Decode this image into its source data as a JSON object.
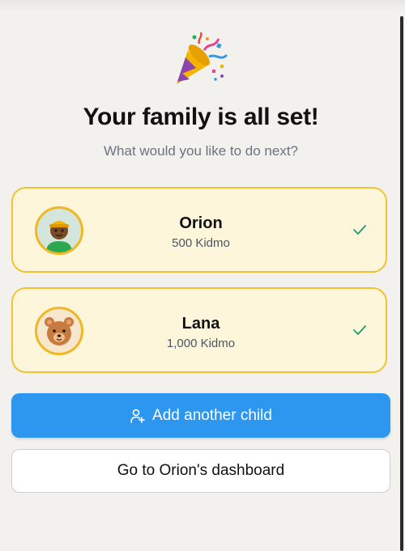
{
  "header": {
    "celebration_icon": "party-popper-icon",
    "title": "Your family is all set!",
    "subtitle": "What would you like to do next?"
  },
  "children": [
    {
      "name": "Orion",
      "balance": "500 Kidmo",
      "avatar": "boy-avatar-icon",
      "selected": true
    },
    {
      "name": "Lana",
      "balance": "1,000 Kidmo",
      "avatar": "bear-avatar-icon",
      "selected": true
    }
  ],
  "actions": {
    "add_child_label": "Add another child",
    "add_child_icon": "add-user-icon",
    "dashboard_label": "Go to Orion's dashboard"
  },
  "colors": {
    "accent_blue": "#2d97ef",
    "card_background": "#fdf6db",
    "card_border": "#f1c232",
    "check_green": "#1f9d6b",
    "page_background": "#f2f1ed"
  }
}
